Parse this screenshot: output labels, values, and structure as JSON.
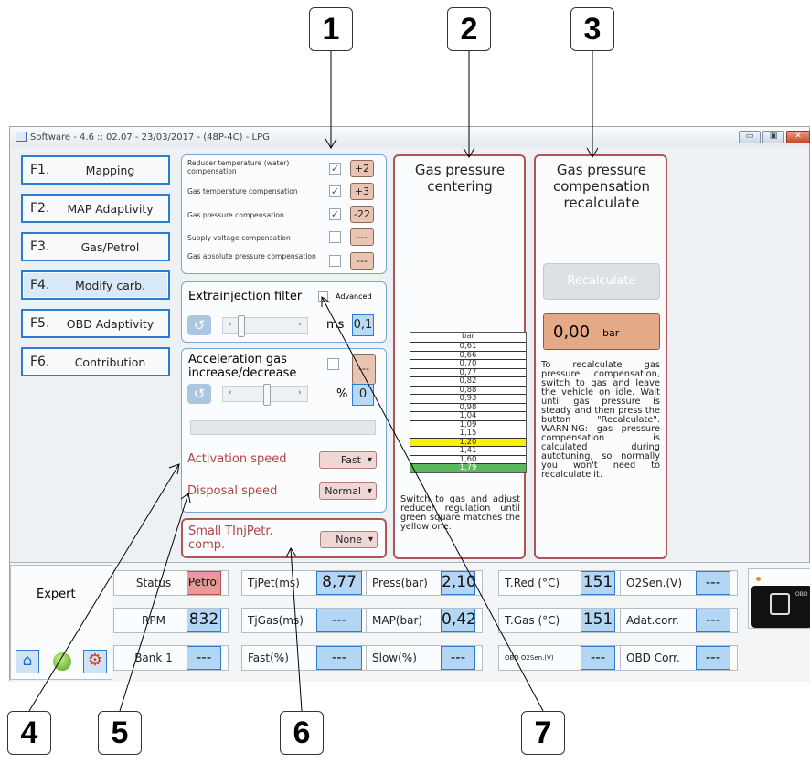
{
  "callouts": {
    "c1": "1",
    "c2": "2",
    "c3": "3",
    "c4": "4",
    "c5": "5",
    "c6": "6",
    "c7": "7"
  },
  "window": {
    "title": "Software - 4.6 :: 02.07 - 23/03/2017 - (48P-4C) - LPG",
    "min": "▭",
    "max": "▣",
    "close": "✕"
  },
  "menu": [
    {
      "key": "F1.",
      "label": "Mapping"
    },
    {
      "key": "F2.",
      "label": "MAP Adaptivity"
    },
    {
      "key": "F3.",
      "label": "Gas/Petrol"
    },
    {
      "key": "F4.",
      "label": "Modify carb."
    },
    {
      "key": "F5.",
      "label": "OBD Adaptivity"
    },
    {
      "key": "F6.",
      "label": "Contribution"
    }
  ],
  "compensations": [
    {
      "label": "Reducer temperature (water) compensation",
      "checked": true,
      "value": "+2"
    },
    {
      "label": "Gas temperature compensation",
      "checked": true,
      "value": "+3"
    },
    {
      "label": "Gas pressure compensation",
      "checked": true,
      "value": "-22"
    },
    {
      "label": "Supply voltage compensation",
      "checked": false,
      "value": "---"
    },
    {
      "label": "Gas absolute pressure compensation",
      "checked": false,
      "value": "---"
    }
  ],
  "extrainjection": {
    "title": "Extrainjection filter",
    "advanced": "Advanced",
    "unit": "ms",
    "value": "0,1"
  },
  "acceleration": {
    "title": "Acceleration gas increase/decrease",
    "value_box": "---",
    "unit": "%",
    "value": "0",
    "activation_label": "Activation speed",
    "activation_value": "Fast",
    "disposal_label": "Disposal speed",
    "disposal_value": "Normal"
  },
  "small_tinj": {
    "label": "Small TInjPetr. comp.",
    "value": "None"
  },
  "gas_centering": {
    "title": "Gas pressure centering",
    "unit": "bar",
    "scale": [
      "0,61",
      "0,66",
      "0,70",
      "0,77",
      "0,82",
      "0,88",
      "0,93",
      "0,98",
      "1,04",
      "1,09",
      "1,15",
      "1,20",
      "1,41",
      "1,60",
      "1,79"
    ],
    "highlight_yellow": "1,20",
    "highlight_green": "1,79",
    "note": "Switch to gas and adjust reducer regulation until green square matches the yellow one."
  },
  "gas_comp": {
    "title": "Gas pressure compensation recalculate",
    "button": "Recalculate",
    "value": "0,00",
    "unit": "bar",
    "note": "To recalculate gas pressure compensation, switch to gas and leave the vehicle on idle. Wait until gas pressure is steady and then press the button \"Recalculate\". WARNING: gas pressure compensation is calculated during autotuning, so normally you won't need to recalculate it."
  },
  "status": {
    "mode": "Expert",
    "rows": [
      [
        {
          "l": "Status",
          "v": "Petrol"
        },
        {
          "l": "TjPet(ms)",
          "v": "8,77"
        },
        {
          "l": "Press(bar)",
          "v": "2,10"
        },
        {
          "l": "T.Red (°C)",
          "v": "151"
        },
        {
          "l": "O2Sen.(V)",
          "v": "---"
        }
      ],
      [
        {
          "l": "RPM",
          "v": "832"
        },
        {
          "l": "TjGas(ms)",
          "v": "---"
        },
        {
          "l": "MAP(bar)",
          "v": "0,42"
        },
        {
          "l": "T.Gas (°C)",
          "v": "151"
        },
        {
          "l": "Adat.corr.",
          "v": "---"
        }
      ],
      [
        {
          "l": "Bank 1",
          "v": "---"
        },
        {
          "l": "Fast(%)",
          "v": "---"
        },
        {
          "l": "Slow(%)",
          "v": "---"
        },
        {
          "l": "OBD O2Sen.(V)",
          "v": "---"
        },
        {
          "l": "OBD Corr.",
          "v": "---"
        }
      ]
    ],
    "device_label": "OBD"
  },
  "colors": {
    "accent": "#2e7ccd",
    "red": "#b04444",
    "yellow": "#f6f400",
    "green": "#5cb85c"
  }
}
